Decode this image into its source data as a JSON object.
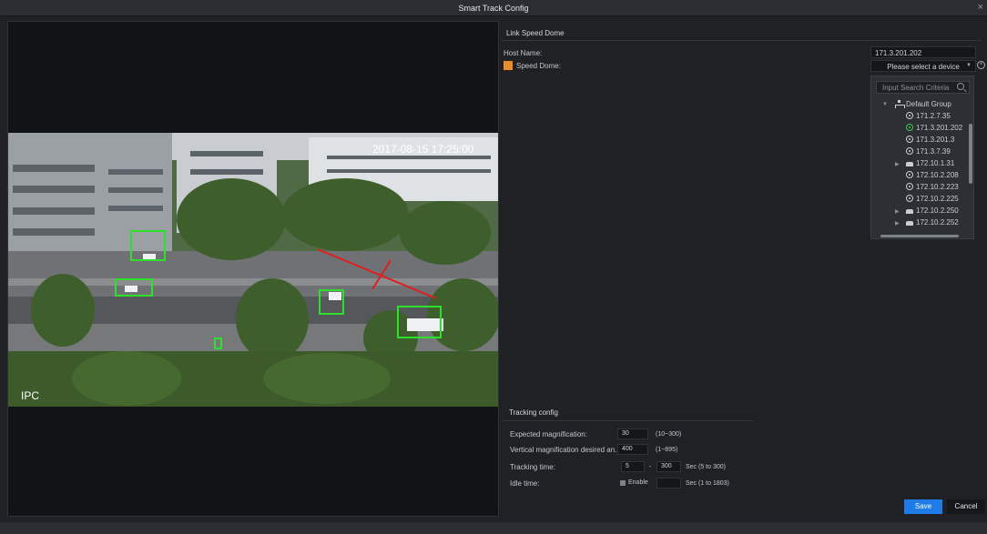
{
  "window": {
    "title": "Smart Track Config",
    "close_symbol": "×"
  },
  "video": {
    "label": "IPC",
    "timestamp": "2017-08-15 17:25:00"
  },
  "link_speed_dome": {
    "heading": "Link Speed Dome",
    "host_name_label": "Host Name:",
    "host_name_value": "171.3.201.202",
    "speed_dome_label": "Speed Dome:",
    "speed_dome_color": "#e98b2a",
    "device_select_placeholder": "Please select a device",
    "search_placeholder": "Input Search Criteria",
    "tree": [
      {
        "label": "Default Group",
        "type": "group",
        "expanded": true
      },
      {
        "label": "171.2.7.35",
        "type": "camera"
      },
      {
        "label": "171.3.201.202",
        "type": "camera",
        "online": true
      },
      {
        "label": "171.3.201.3",
        "type": "camera"
      },
      {
        "label": "171.3.7.39",
        "type": "camera"
      },
      {
        "label": "172.10.1.31",
        "type": "nvr"
      },
      {
        "label": "172.10.2.208",
        "type": "camera"
      },
      {
        "label": "172.10.2.223",
        "type": "camera"
      },
      {
        "label": "172.10.2.225",
        "type": "camera"
      },
      {
        "label": "172.10.2.250",
        "type": "nvr"
      },
      {
        "label": "172.10.2.252",
        "type": "nvr"
      }
    ]
  },
  "tracking_config": {
    "heading": "Tracking config",
    "expected_magnification": {
      "label": "Expected magnification:",
      "value": "30",
      "range": "(10~300)"
    },
    "vertical_magnification": {
      "label": "Vertical magnification desired an...",
      "value": "400",
      "range": "(1~895)"
    },
    "tracking_time": {
      "label": "Tracking time:",
      "min": "5",
      "separator": "-",
      "max": "300",
      "range": "Sec (5 to 300)"
    },
    "idle_time": {
      "label": "Idle time:",
      "enable_label": "Enable",
      "enabled": false,
      "value": "",
      "range": "Sec (1 to 1803)"
    }
  },
  "buttons": {
    "save": "Save",
    "cancel": "Cancel",
    "save_color": "#1f7be8"
  }
}
